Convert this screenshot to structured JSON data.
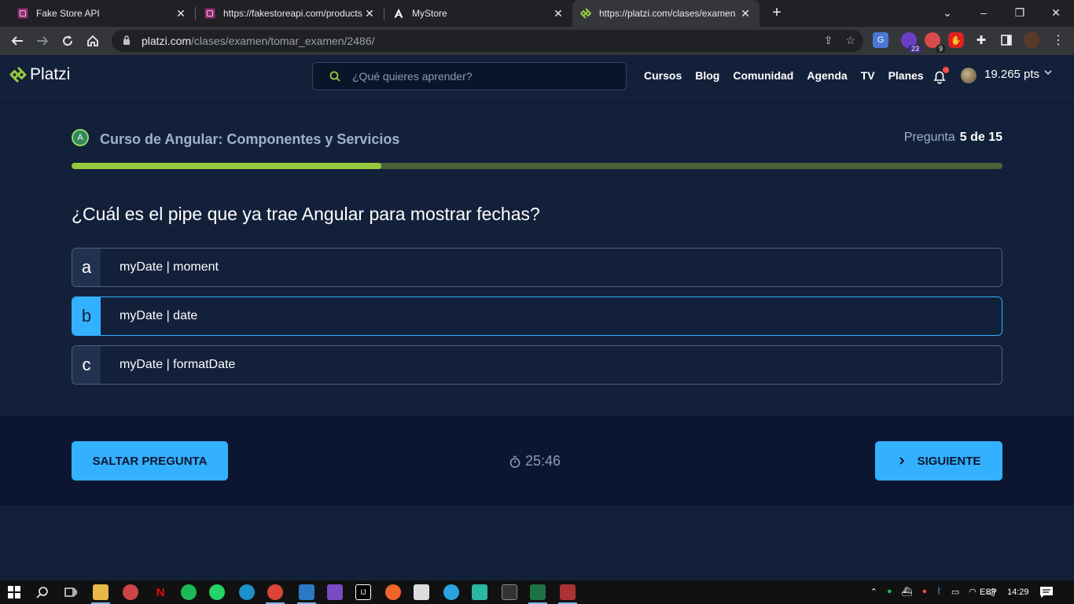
{
  "browser": {
    "tabs": [
      {
        "title": "Fake Store API",
        "favicon": "fakestore-icon",
        "active": false
      },
      {
        "title": "https://fakestoreapi.com/products",
        "favicon": "fakestore-icon",
        "active": false
      },
      {
        "title": "MyStore",
        "favicon": "angular-icon",
        "active": false
      },
      {
        "title": "https://platzi.com/clases/examen",
        "favicon": "platzi-icon",
        "active": true
      }
    ],
    "url_host": "platzi.com",
    "url_path": "/clases/examen/tomar_examen/2486/",
    "extensions": [
      {
        "name": "google-translate-icon",
        "badge": ""
      },
      {
        "name": "extension-purple-icon",
        "badge": "23"
      },
      {
        "name": "extension-red-icon",
        "badge": "9"
      },
      {
        "name": "adblock-icon",
        "badge": ""
      }
    ]
  },
  "site": {
    "logo_text": "Platzi",
    "search_placeholder": "¿Qué quieres aprender?",
    "nav": [
      "Cursos",
      "Blog",
      "Comunidad",
      "Agenda",
      "TV",
      "Planes"
    ],
    "points": "19.265 pts"
  },
  "exam": {
    "course_title": "Curso de Angular: Componentes y Servicios",
    "question_label": "Pregunta",
    "question_number": "5 de 15",
    "progress_fraction": 0.333,
    "question": "¿Cuál es el pipe que ya trae Angular para mostrar fechas?",
    "options": [
      {
        "letter": "a",
        "text": "myDate | moment",
        "selected": false
      },
      {
        "letter": "b",
        "text": "myDate | date",
        "selected": true
      },
      {
        "letter": "c",
        "text": "myDate | formatDate",
        "selected": false
      }
    ],
    "skip_label": "SALTAR PREGUNTA",
    "next_label": "SIGUIENTE",
    "timer": "25:46"
  },
  "taskbar": {
    "language": "ESP",
    "time": "14:29"
  },
  "colors": {
    "accent": "#33b1ff",
    "progress": "#98ca3f",
    "background": "#13203a"
  }
}
